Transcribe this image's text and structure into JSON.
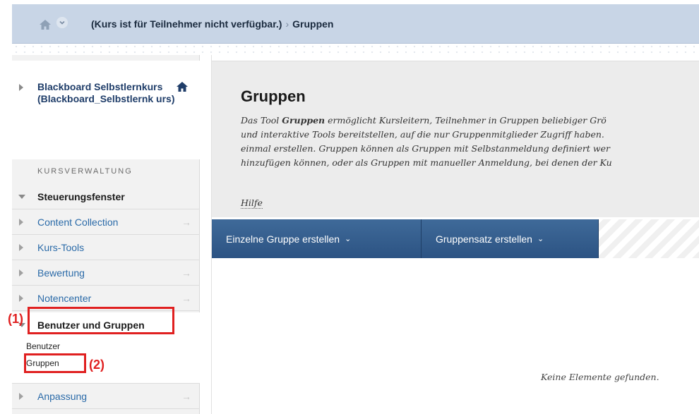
{
  "breadcrumb": {
    "course": "(Kurs ist für Teilnehmer nicht verfügbar.)",
    "separator": "›",
    "current": "Gruppen"
  },
  "sidebar": {
    "course_name": "Blackboard Selbstlernkurs (Blackboard_Selbstlernk urs)",
    "section_label": "KURSVERWALTUNG",
    "control_panel": "Steuerungsfenster",
    "items": [
      {
        "label": "Content Collection",
        "arrow": "→"
      },
      {
        "label": "Kurs-Tools",
        "arrow": ""
      },
      {
        "label": "Bewertung",
        "arrow": "→"
      },
      {
        "label": "Notencenter",
        "arrow": "→"
      },
      {
        "label": "Benutzer und Gruppen",
        "arrow": ""
      },
      {
        "label": "Anpassung",
        "arrow": "→"
      }
    ],
    "sub_items": [
      "Benutzer",
      "Gruppen"
    ]
  },
  "annotations": {
    "marker_1": "(1)",
    "marker_2": "(2)",
    "color": "#e02020"
  },
  "main": {
    "title": "Gruppen",
    "description_lines": [
      "Das Tool Gruppen ermöglicht Kursleitern, Teilnehmer in Gruppen beliebiger Grö",
      "und interaktive Tools bereitstellen, auf die nur Gruppenmitglieder Zugriff haben. ",
      "einmal erstellen. Gruppen können als Gruppen mit Selbstanmeldung definiert wer",
      "hinzufügen können, oder als Gruppen mit manueller Anmeldung, bei denen der Ku"
    ],
    "help_link": "Hilfe",
    "buttons": [
      {
        "label": "Einzelne Gruppe erstellen",
        "chevron": "⌄"
      },
      {
        "label": "Gruppensatz erstellen",
        "chevron": "⌄"
      }
    ],
    "empty_message": "Keine Elemente gefunden."
  },
  "colors": {
    "breadcrumb_bg": "#c8d5e6",
    "link_blue": "#2a6aa8",
    "button_blue": "#2c5383",
    "annotation_red": "#e02020"
  }
}
